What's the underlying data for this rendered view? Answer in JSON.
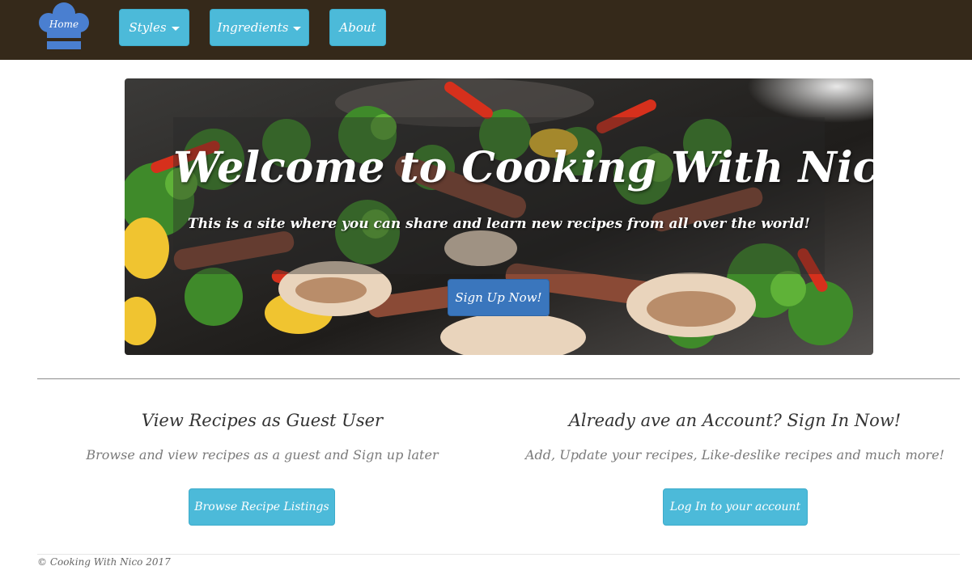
{
  "nav": {
    "home_label": "Home",
    "items": [
      {
        "label": "Styles",
        "has_dropdown": true
      },
      {
        "label": "Ingredients",
        "has_dropdown": true
      },
      {
        "label": "About",
        "has_dropdown": false
      }
    ]
  },
  "hero": {
    "title": "Welcome to Cooking With Nico!",
    "subtitle": "This is a site where you can share and learn new recipes from all over the world!",
    "cta_label": "Sign Up Now!"
  },
  "guest": {
    "title": "View Recipes as Guest User",
    "description": "Browse and view recipes as a guest and Sign up later",
    "button_label": "Browse Recipe Listings"
  },
  "account": {
    "title": "Already ave an Account? Sign In Now!",
    "description": "Add, Update your recipes, Like-deslike recipes and much more!",
    "button_label": "Log In to your account"
  },
  "footer": {
    "text": "© Cooking With Nico 2017"
  },
  "colors": {
    "navbar_bg": "#35291a",
    "nav_button": "#4cbad9",
    "cta_button": "#3a76bd",
    "logo_hat": "#4a7fd0"
  },
  "icons": {
    "logo": "chef-hat-icon",
    "dropdown": "caret-down-icon"
  }
}
